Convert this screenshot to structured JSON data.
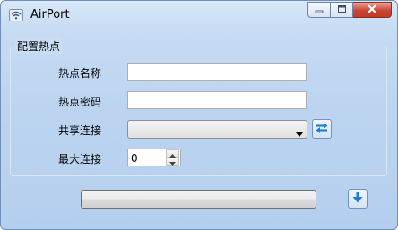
{
  "window": {
    "title": "AirPort",
    "app_icon": "wifi-icon",
    "controls": [
      "minimize-icon",
      "maximize-icon",
      "close-icon"
    ]
  },
  "group": {
    "legend": "配置热点",
    "fields": {
      "ssid_label": "热点名称",
      "ssid_value": "",
      "password_label": "热点密码",
      "password_value": "",
      "share_label": "共享连接",
      "share_selected": "",
      "max_label": "最大连接",
      "max_value": "0"
    }
  },
  "buttons": {
    "refresh_icon": "swap-arrows-icon",
    "main_button_label": "",
    "download_icon": "arrow-down-icon"
  },
  "colors": {
    "accent": "#1e7fd6",
    "close": "#c94432"
  }
}
